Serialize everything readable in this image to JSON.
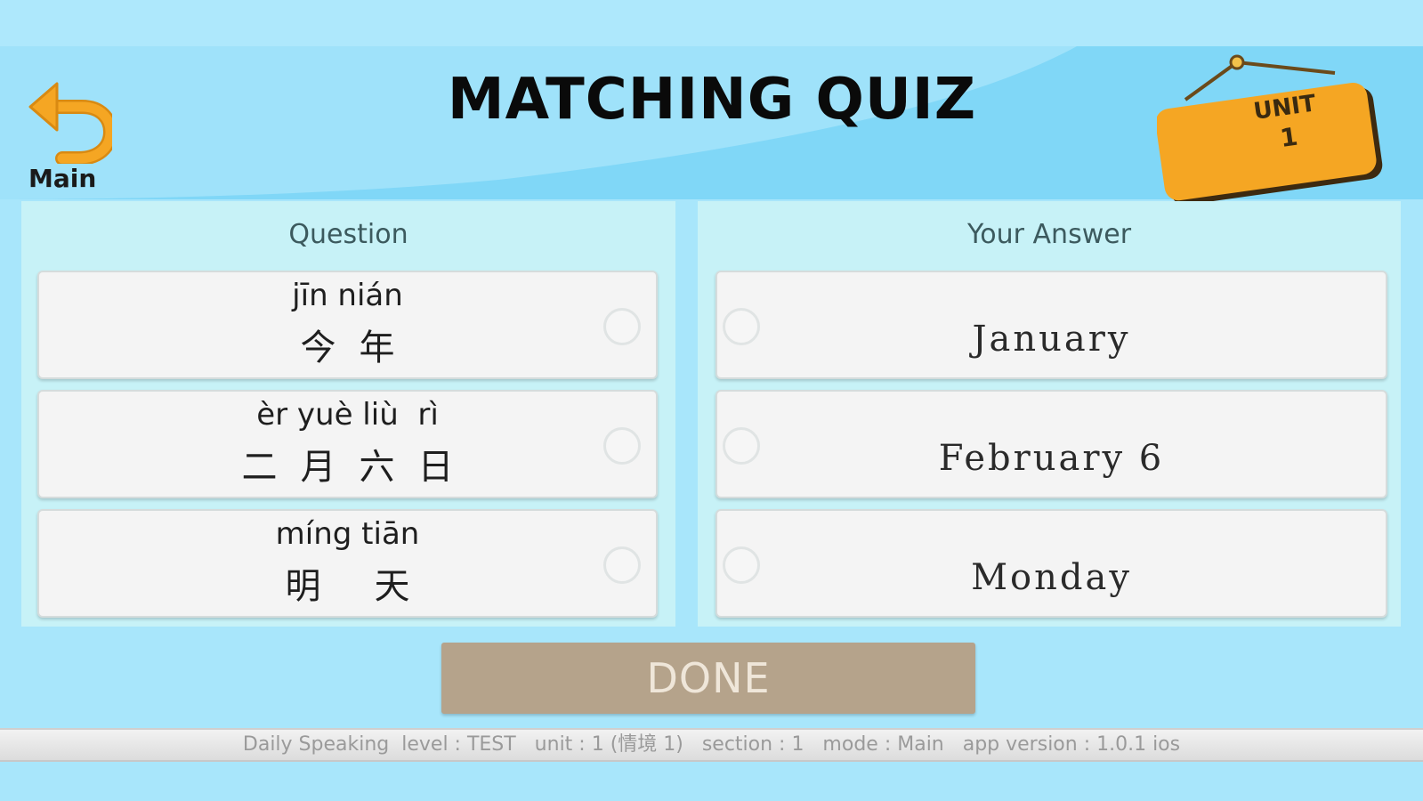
{
  "header": {
    "title": "MATCHING QUIZ",
    "back_label": "Main",
    "unit_label": "UNIT",
    "unit_number": "1"
  },
  "question_panel": {
    "heading": "Question",
    "items": [
      {
        "pinyin": "jīn nián",
        "hanzi": "今年"
      },
      {
        "pinyin": "èr yuè liù  rì",
        "hanzi": "二月六日"
      },
      {
        "pinyin": "míng tiān",
        "hanzi": "明天"
      }
    ]
  },
  "answer_panel": {
    "heading": "Your Answer",
    "items": [
      {
        "text": "January"
      },
      {
        "text": "February 6"
      },
      {
        "text": "Monday"
      }
    ]
  },
  "done_label": "DONE",
  "status_bar": "Daily Speaking  level : TEST   unit : 1 (情境 1)   section : 1   mode : Main   app version : 1.0.1 ios",
  "colors": {
    "background": "#a8e6fb",
    "header": "#80d7f7",
    "panel": "#c7f2f7",
    "accent_orange": "#f5a623",
    "done_button": "#b5a38b"
  },
  "icons": {
    "back": "undo-arrow-icon",
    "unit": "hanging-sign-icon"
  }
}
